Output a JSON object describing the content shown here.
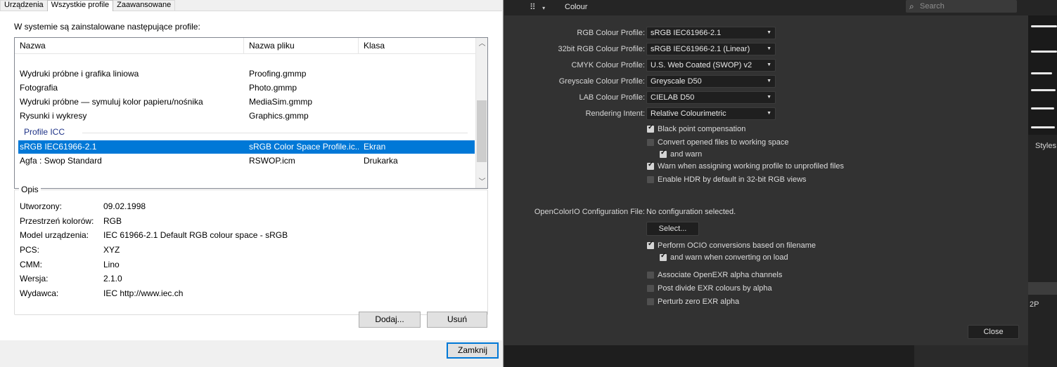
{
  "dialog": {
    "tabs": [
      {
        "label": "Urządzenia"
      },
      {
        "label": "Wszystkie profile"
      },
      {
        "label": "Zaawansowane"
      }
    ],
    "intro": "W systemie są zainstalowane następujące profile:",
    "columns": [
      "Nazwa",
      "Nazwa pliku",
      "Klasa"
    ],
    "rows": [
      {
        "name": "Wydruki próbne i grafika liniowa",
        "file": "Proofing.gmmp",
        "class": ""
      },
      {
        "name": "Fotografia",
        "file": "Photo.gmmp",
        "class": ""
      },
      {
        "name": "Wydruki próbne — symuluj kolor papieru/nośnika",
        "file": "MediaSim.gmmp",
        "class": ""
      },
      {
        "name": "Rysunki i wykresy",
        "file": "Graphics.gmmp",
        "class": ""
      }
    ],
    "group_label": "Profile ICC",
    "icc_rows": [
      {
        "name": "sRGB IEC61966-2.1",
        "file": "sRGB Color Space Profile.ic...",
        "class": "Ekran"
      },
      {
        "name": "Agfa : Swop Standard",
        "file": "RSWOP.icm",
        "class": "Drukarka"
      }
    ],
    "opis": {
      "legend": "Opis",
      "fields": [
        {
          "k": "Utworzony:",
          "v": "09.02.1998"
        },
        {
          "k": "Przestrzeń kolorów:",
          "v": "RGB"
        },
        {
          "k": "Model urządzenia:",
          "v": "IEC 61966-2.1 Default RGB colour space - sRGB"
        },
        {
          "k": "PCS:",
          "v": "XYZ"
        },
        {
          "k": "CMM:",
          "v": "Lino"
        },
        {
          "k": "Wersja:",
          "v": "2.1.0"
        },
        {
          "k": "Wydawca:",
          "v": "IEC http://www.iec.ch"
        }
      ]
    },
    "buttons": {
      "add": "Dodaj...",
      "remove": "Usuń",
      "close": "Zamknij"
    }
  },
  "app": {
    "title": "Colour",
    "search_placeholder": "Search",
    "profiles": [
      {
        "label": "RGB Colour Profile:",
        "value": "sRGB IEC61966-2.1"
      },
      {
        "label": "32bit RGB Colour Profile:",
        "value": "sRGB IEC61966-2.1 (Linear)"
      },
      {
        "label": "CMYK Colour Profile:",
        "value": "U.S. Web Coated (SWOP) v2"
      },
      {
        "label": "Greyscale Colour Profile:",
        "value": "Greyscale D50"
      },
      {
        "label": "LAB Colour Profile:",
        "value": "CIELAB D50"
      },
      {
        "label": "Rendering Intent:",
        "value": "Relative Colourimetric"
      }
    ],
    "checks1": [
      {
        "label": "Black point compensation",
        "checked": true
      },
      {
        "label": "Convert opened files to working space",
        "checked": false
      },
      {
        "label": "and warn",
        "checked": true
      },
      {
        "label": "Warn when assigning working profile to unprofiled files",
        "checked": true
      },
      {
        "label": "Enable HDR by default in 32-bit RGB views",
        "checked": false
      }
    ],
    "ocio": {
      "label": "OpenColorIO Configuration File:",
      "value": "No configuration selected.",
      "select_button": "Select..."
    },
    "checks2": [
      {
        "label": "Perform OCIO conversions based on filename",
        "checked": true
      },
      {
        "label": "and warn when converting on load",
        "checked": true
      },
      {
        "label": "Associate OpenEXR alpha channels",
        "checked": false
      },
      {
        "label": "Post divide EXR colours by alpha",
        "checked": false
      },
      {
        "label": "Perturb zero EXR alpha",
        "checked": false
      }
    ],
    "close_button": "Close",
    "sidebar": {
      "styles_tab": "Styles",
      "label_2p": "2P"
    }
  }
}
